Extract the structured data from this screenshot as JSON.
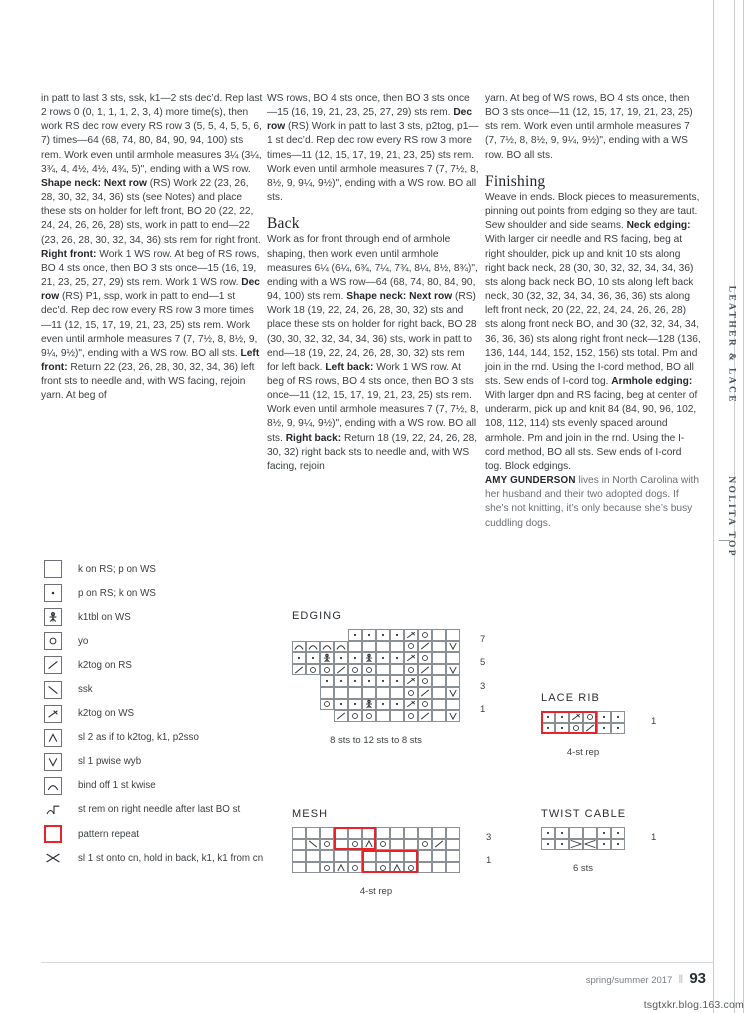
{
  "columns": {
    "col1": [
      {
        "type": "p",
        "runs": [
          {
            "t": "in patt to last 3 sts, ssk, k1—2 sts dec’d. Rep last 2 rows 0 (0, 1, 1, 1, 2, 3, 4) more time(s), then work RS dec row every RS row 3 (5, 5, 4, 5, 5, 6, 7) times—64 (68, 74, 80, 84, 90, 94, 100) sts rem. Work even until armhole measures 3¼ (3¼, 3¾, 4, 4½, 4½, 4¾, 5)\", ending with a WS row. "
          },
          {
            "t": "Shape neck: Next row",
            "b": true
          },
          {
            "t": " (RS) Work 22 (23, 26, 28, 30, 32, 34, 36) sts (see Notes) and place these sts on holder for left front, BO 20 (22, 22, 24, 24, 26, 26, 28) sts, work in patt to end—22 (23, 26, 28, 30, 32, 34, 36) sts rem for right front. "
          },
          {
            "t": "Right front:",
            "b": true
          },
          {
            "t": " Work 1 WS row. At beg of RS rows, BO 4 sts once, then BO 3 sts once—15 (16, 19, 21, 23, 25, 27, 29) sts rem. Work 1 WS row. "
          },
          {
            "t": "Dec row",
            "b": true
          },
          {
            "t": " (RS) P1, ssp, work in patt to end—1 st dec’d. Rep dec row every RS row 3 more times—11 (12, 15, 17, 19, 21, 23, 25) sts rem. Work even until armhole measures 7 (7, 7½, 8, 8½, 9, 9¼, 9½)\", ending with a WS row. BO all sts. "
          },
          {
            "t": "Left front:",
            "b": true
          },
          {
            "t": " Return 22 (23, 26, 28, 30, 32, 34, 36) left front sts to needle and, with WS facing, rejoin yarn. At beg of"
          }
        ]
      }
    ],
    "col2": [
      {
        "type": "p",
        "runs": [
          {
            "t": "WS rows, BO 4 sts once, then BO 3 sts once—15 (16, 19, 21, 23, 25, 27, 29) sts rem. "
          },
          {
            "t": "Dec row",
            "b": true
          },
          {
            "t": " (RS) Work in patt to last 3 sts, p2tog, p1—1 st dec’d. Rep dec row every RS row 3 more times—11 (12, 15, 17, 19, 21, 23, 25) sts rem. Work even until armhole measures 7 (7, 7½, 8, 8½, 9, 9¼, 9½)\", ending with a WS row. BO all sts."
          }
        ]
      },
      {
        "type": "h2",
        "text": "Back"
      },
      {
        "type": "p",
        "runs": [
          {
            "t": "Work as for front through end of armhole shaping, then work even until armhole measures 6¼ (6¼, 6¾, 7¼, 7¾, 8¼, 8½, 8¾)\", ending with a WS row—64 (68, 74, 80, 84, 90, 94, 100) sts rem. "
          },
          {
            "t": "Shape neck: Next row",
            "b": true
          },
          {
            "t": " (RS) Work 18 (19, 22, 24, 26, 28, 30, 32) sts and place these sts on holder for right back, BO 28 (30, 30, 32, 32, 34, 34, 36) sts, work in patt to end—18 (19, 22, 24, 26, 28, 30, 32) sts rem for left back. "
          },
          {
            "t": "Left back:",
            "b": true
          },
          {
            "t": " Work 1 WS row. At beg of RS rows, BO 4 sts once, then BO 3 sts once—11 (12, 15, 17, 19, 21, 23, 25) sts rem. Work even until armhole measures 7 (7, 7½, 8, 8½, 9, 9¼, 9½)\", ending with a WS row. BO all sts. "
          },
          {
            "t": "Right back:",
            "b": true
          },
          {
            "t": " Return 18 (19, 22, 24, 26, 28, 30, 32) right back sts to needle and, with WS facing, rejoin"
          }
        ]
      }
    ],
    "col3": [
      {
        "type": "p",
        "runs": [
          {
            "t": "yarn. At beg of WS rows, BO 4 sts once, then BO 3 sts once—11 (12, 15, 17, 19, 21, 23, 25) sts rem. Work even until armhole measures 7 (7, 7½, 8, 8½, 9, 9¼, 9½)\", ending with a WS row. BO all sts."
          }
        ]
      },
      {
        "type": "h2",
        "text": "Finishing"
      },
      {
        "type": "p",
        "runs": [
          {
            "t": "Weave in ends. Block pieces to mea­surements, pinning out points from edging so they are taut. Sew shoulder and side seams. "
          },
          {
            "t": "Neck edging:",
            "b": true
          },
          {
            "t": " With larger cir needle and RS facing, beg at right shoulder, pick up and knit 10 sts along right back neck, 28 (30, 30, 32, 32, 34, 34, 36) sts along back neck BO, 10 sts along left back neck, 30 (32, 32, 34, 34, 36, 36, 36) sts along left front neck, 20 (22, 22, 24, 24, 26, 26, 28) sts along front neck BO, and 30 (32, 32, 34, 34, 36, 36, 36) sts along right front neck—128 (136, 136, 144, 144, 152, 152, 156) sts total. Pm and join in the rnd. Using the I-cord method, BO all sts. Sew ends of I-cord tog. "
          },
          {
            "t": "Armhole edg­ing:",
            "b": true
          },
          {
            "t": " With larger dpn and RS facing, beg at center of underarm, pick up and knit 84 (84, 90, 96, 102, 108, 112, 114) sts evenly spaced around armhole. Pm and join in the rnd. Using the I-cord method, BO all sts. Sew ends of I-cord tog. Block edgings."
          }
        ]
      },
      {
        "type": "byline",
        "author": "AMY GUNDERSON",
        "text": " lives in North Carolina with her husband and their two adopted dogs. If she’s not knitting, it’s only because she’s busy cuddling dogs."
      }
    ]
  },
  "legend": {
    "items": [
      {
        "symbol": "empty",
        "label": "k on RS; p on WS"
      },
      {
        "symbol": "purl",
        "label": "p on RS; k on WS"
      },
      {
        "symbol": "k1tbl",
        "label": "k1tbl on WS"
      },
      {
        "symbol": "yo",
        "label": "yo"
      },
      {
        "symbol": "k2tog",
        "label": "k2tog on RS"
      },
      {
        "symbol": "ssk",
        "label": "ssk"
      },
      {
        "symbol": "k2togws",
        "label": "k2tog on WS"
      },
      {
        "symbol": "cdd",
        "label": "sl 2 as if to k2tog, k1, p2sso"
      },
      {
        "symbol": "slwyb",
        "label": "sl 1 pwise wyb"
      },
      {
        "symbol": "bindoff",
        "label": "bind off 1 st kwise"
      },
      {
        "symbol": "strem",
        "label": "st rem on right needle after last BO st"
      },
      {
        "symbol": "repeat",
        "label": "pattern repeat"
      },
      {
        "symbol": "cable",
        "label": "sl 1 st onto cn, hold in back, k1, k1 from cn"
      }
    ]
  },
  "charts": {
    "edging": {
      "title": "EDGING",
      "caption": "8 sts to 12 sts to 8 sts",
      "row_numbers": [
        "7",
        "5",
        "3",
        "1"
      ],
      "cols": 12,
      "rows": 8,
      "grid": [
        [
          "x",
          "x",
          "x",
          "x",
          "purl",
          "purl",
          "purl",
          "purl",
          "k2togws",
          "yo",
          "empty",
          "empty"
        ],
        [
          "bindoff",
          "bindoff",
          "bindoff",
          "bindoff",
          "empty",
          "empty",
          "empty",
          "empty",
          "yo",
          "k2tog",
          "empty",
          "slwyb"
        ],
        [
          "purl",
          "purl",
          "k1tbl",
          "purl",
          "purl",
          "k1tbl",
          "purl",
          "purl",
          "k2togws",
          "yo",
          "empty",
          "empty"
        ],
        [
          "k2tog",
          "yo",
          "yo",
          "k2tog",
          "yo",
          "yo",
          "empty",
          "empty",
          "yo",
          "k2tog",
          "empty",
          "slwyb"
        ],
        [
          "x",
          "x",
          "purl",
          "purl",
          "purl",
          "purl",
          "purl",
          "purl",
          "k2togws",
          "yo",
          "empty",
          "empty"
        ],
        [
          "x",
          "x",
          "empty",
          "empty",
          "empty",
          "empty",
          "empty",
          "empty",
          "yo",
          "k2tog",
          "empty",
          "slwyb"
        ],
        [
          "x",
          "x",
          "yo",
          "purl",
          "purl",
          "k1tbl",
          "purl",
          "purl",
          "k2togws",
          "yo",
          "empty",
          "empty"
        ],
        [
          "x",
          "x",
          "x",
          "k2tog",
          "yo",
          "yo",
          "empty",
          "empty",
          "yo",
          "k2tog",
          "empty",
          "slwyb"
        ]
      ]
    },
    "mesh": {
      "title": "MESH",
      "caption": "4-st rep",
      "row_numbers": [
        "3",
        "1"
      ],
      "cols": 12,
      "rows": 4,
      "grid": [
        [
          "empty",
          "empty",
          "empty",
          "empty",
          "empty",
          "empty",
          "empty",
          "empty",
          "empty",
          "empty",
          "empty",
          "empty"
        ],
        [
          "empty",
          "ssk",
          "yo",
          "empty",
          "yo",
          "cdd",
          "yo",
          "empty",
          "empty",
          "yo",
          "k2tog",
          "empty"
        ],
        [
          "empty",
          "empty",
          "empty",
          "empty",
          "empty",
          "empty",
          "empty",
          "empty",
          "empty",
          "empty",
          "empty",
          "empty"
        ],
        [
          "empty",
          "empty",
          "yo",
          "cdd",
          "yo",
          "empty",
          "yo",
          "cdd",
          "yo",
          "empty",
          "empty",
          "empty"
        ]
      ]
    },
    "lace_rib": {
      "title": "LACE RIB",
      "caption": "4-st rep",
      "row_numbers": [
        "1"
      ],
      "cols": 6,
      "rows": 2,
      "grid": [
        [
          "purl",
          "purl",
          "k2togws",
          "yo",
          "purl",
          "purl"
        ],
        [
          "purl",
          "purl",
          "yo",
          "k2tog",
          "purl",
          "purl"
        ]
      ]
    },
    "twist_cable": {
      "title": "TWIST CABLE",
      "caption": "6 sts",
      "row_numbers": [
        "1"
      ],
      "cols": 6,
      "rows": 2,
      "grid": [
        [
          "purl",
          "purl",
          "empty",
          "empty",
          "purl",
          "purl"
        ],
        [
          "purl",
          "purl",
          "cableL",
          "cableR",
          "purl",
          "purl"
        ]
      ]
    }
  },
  "sidebar": {
    "line1": "LEATHER & LACE",
    "line2": "NOLITA TOP"
  },
  "footer": {
    "issue": "spring/summer 2017",
    "page": "93",
    "watermark": "tsgtxkr.blog.163.com"
  },
  "colors": {
    "repeat_red": "#e8232a",
    "grid_line": "#8b9097",
    "text": "#3c4043"
  }
}
